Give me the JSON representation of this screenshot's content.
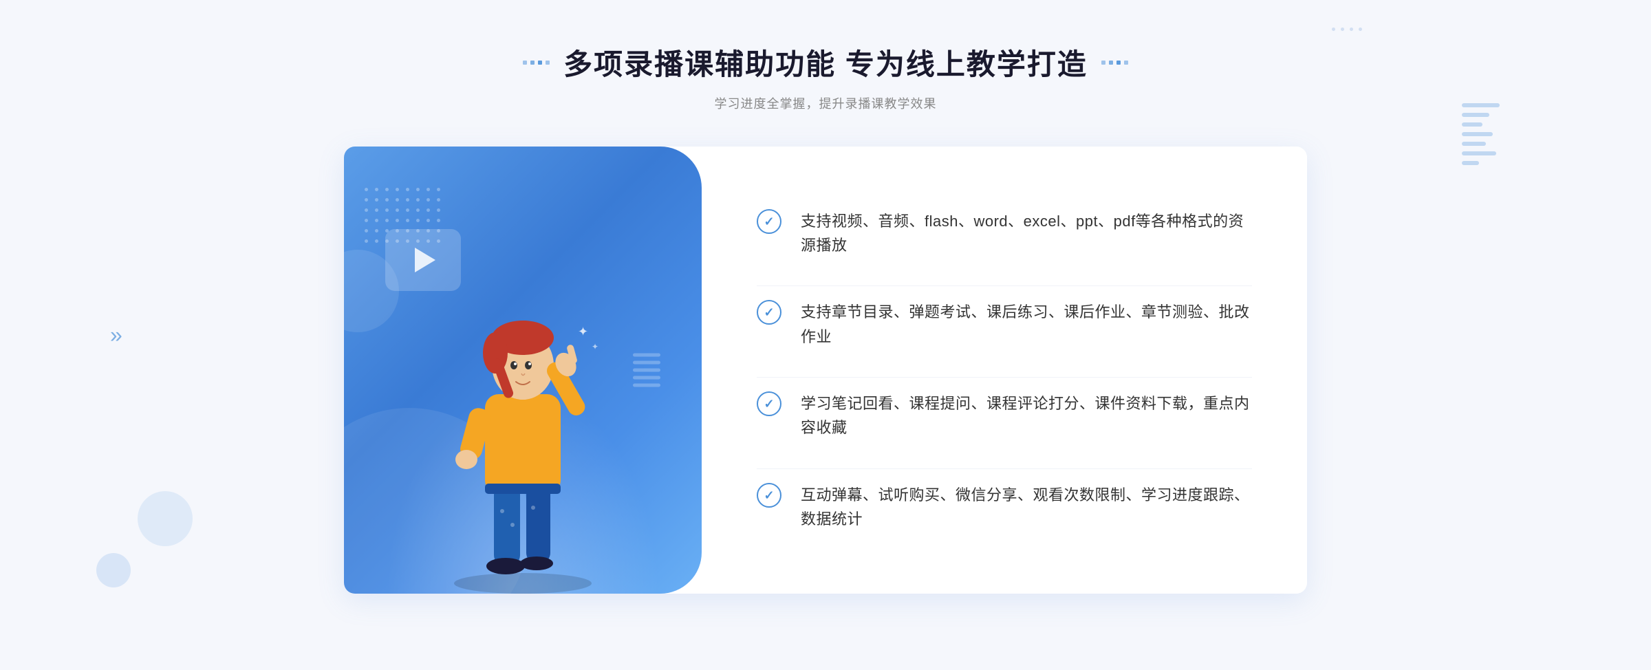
{
  "header": {
    "title": "多项录播课辅助功能 专为线上教学打造",
    "subtitle": "学习进度全掌握，提升录播课教学效果"
  },
  "features": [
    {
      "id": "feature-1",
      "text": "支持视频、音频、flash、word、excel、ppt、pdf等各种格式的资源播放"
    },
    {
      "id": "feature-2",
      "text": "支持章节目录、弹题考试、课后练习、课后作业、章节测验、批改作业"
    },
    {
      "id": "feature-3",
      "text": "学习笔记回看、课程提问、课程评论打分、课件资料下载，重点内容收藏"
    },
    {
      "id": "feature-4",
      "text": "互动弹幕、试听购买、微信分享、观看次数限制、学习进度跟踪、数据统计"
    }
  ],
  "decorations": {
    "left_arrow": "»",
    "check_symbol": "✓"
  }
}
